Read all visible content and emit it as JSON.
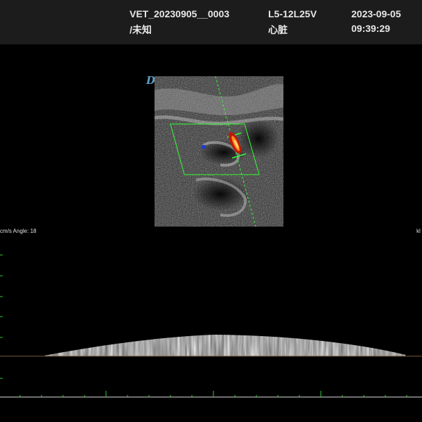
{
  "header": {
    "patient_id": "VET_20230905__0003",
    "patient_sub": "/未知",
    "probe": "L5-12L25V",
    "exam": "心脏",
    "date": "2023-09-05",
    "time": "09:39:29"
  },
  "image_marker": "D",
  "doppler": {
    "info": "cm/s  Angle: 18",
    "right_label": "kl"
  },
  "colors": {
    "background": "#000000",
    "header_bg": "#1c1c1c",
    "scale_ticks": "#33cc33",
    "baseline": "#7a5a3a",
    "color_box": "#33ff33"
  }
}
